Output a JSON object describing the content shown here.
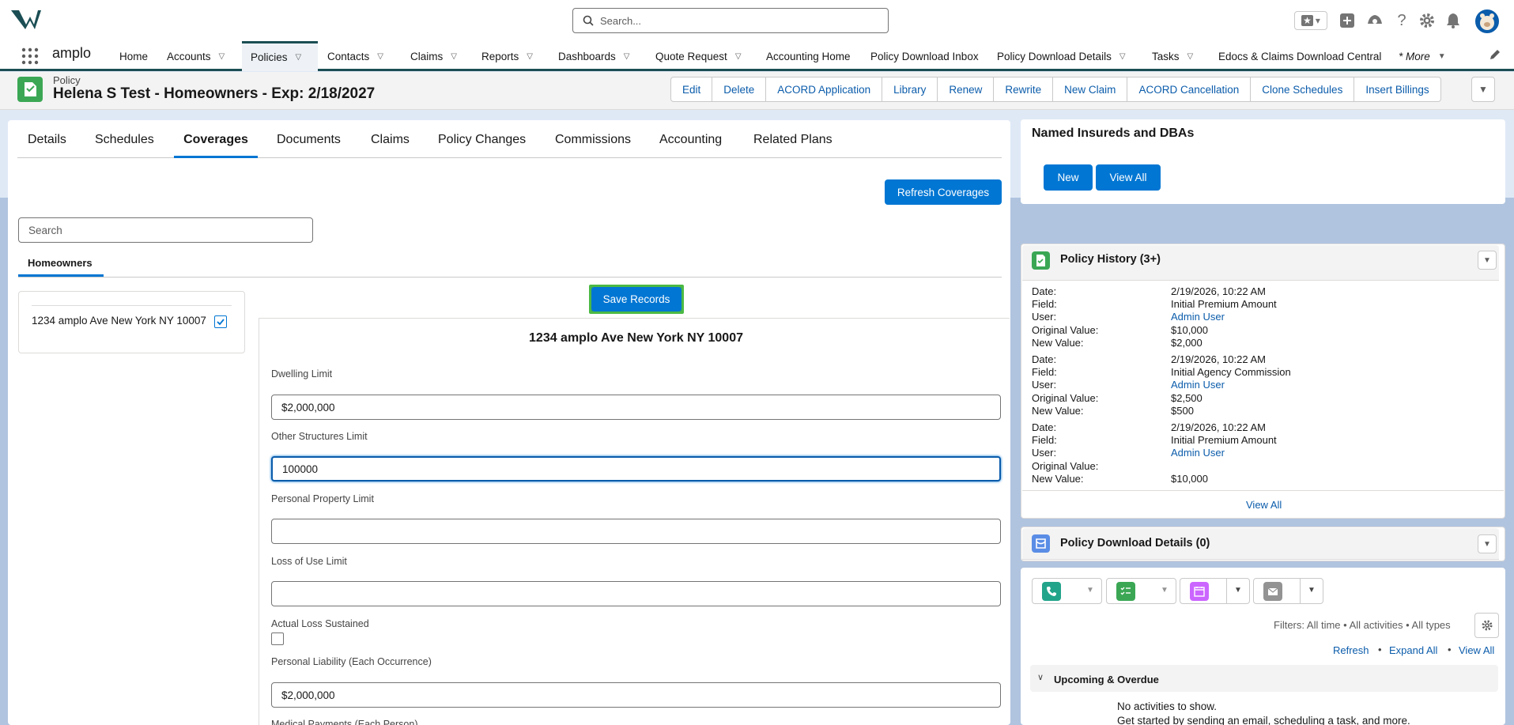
{
  "header": {
    "search_placeholder": "Search..."
  },
  "nav": {
    "app_name": "amplo",
    "items": [
      {
        "label": "Home"
      },
      {
        "label": "Accounts"
      },
      {
        "label": "Policies"
      },
      {
        "label": "Contacts"
      },
      {
        "label": "Claims"
      },
      {
        "label": "Reports"
      },
      {
        "label": "Dashboards"
      },
      {
        "label": "Quote Request"
      },
      {
        "label": "Accounting Home"
      },
      {
        "label": "Policy Download Inbox"
      },
      {
        "label": "Policy Download Details"
      },
      {
        "label": "Tasks"
      },
      {
        "label": "Edocs & Claims Download Central"
      },
      {
        "label": "* More"
      }
    ]
  },
  "record": {
    "type": "Policy",
    "title": "Helena S Test - Homeowners - Exp: 2/18/2027",
    "actions": [
      "Edit",
      "Delete",
      "ACORD Application",
      "Library",
      "Renew",
      "Rewrite",
      "New Claim",
      "ACORD Cancellation",
      "Clone Schedules",
      "Insert Billings"
    ]
  },
  "tabs": [
    "Details",
    "Schedules",
    "Coverages",
    "Documents",
    "Claims",
    "Policy Changes",
    "Commissions",
    "Accounting",
    "Related Plans"
  ],
  "coverages": {
    "refresh_label": "Refresh Coverages",
    "search_placeholder": "Search",
    "subtab": "Homeowners",
    "location": "1234 amplo Ave New York NY 10007",
    "save_label": "Save Records",
    "form_title": "1234 amplo Ave New York NY 10007",
    "fields": [
      {
        "label": "Dwelling Limit",
        "value": "$2,000,000"
      },
      {
        "label": "Other Structures Limit",
        "value": "100000"
      },
      {
        "label": "Personal Property Limit",
        "value": ""
      },
      {
        "label": "Loss of Use Limit",
        "value": ""
      },
      {
        "label": "Actual Loss Sustained",
        "value": ""
      },
      {
        "label": "Personal Liability (Each Occurrence)",
        "value": "$2,000,000"
      },
      {
        "label": "Medical Payments (Each Person)",
        "value": ""
      }
    ]
  },
  "named_insureds": {
    "title": "Named Insureds and DBAs",
    "new_label": "New",
    "view_all_label": "View All"
  },
  "policy_history": {
    "title": "Policy History (3+)",
    "labels": {
      "date": "Date:",
      "field": "Field:",
      "user": "User:",
      "original": "Original Value:",
      "new": "New Value:"
    },
    "entries": [
      {
        "date": "2/19/2026, 10:22 AM",
        "field": "Initial Premium Amount",
        "user": "Admin User",
        "original": "$10,000",
        "new": "$2,000"
      },
      {
        "date": "2/19/2026, 10:22 AM",
        "field": "Initial Agency Commission",
        "user": "Admin User",
        "original": "$2,500",
        "new": "$500"
      },
      {
        "date": "2/19/2026, 10:22 AM",
        "field": "Initial Premium Amount",
        "user": "Admin User",
        "original": "",
        "new": "$10,000"
      }
    ],
    "view_all_label": "View All"
  },
  "policy_download": {
    "title": "Policy Download Details (0)"
  },
  "activity": {
    "filters": "Filters: All time • All activities • All types",
    "refresh": "Refresh",
    "expand_all": "Expand All",
    "view_all": "View All",
    "section": "Upcoming & Overdue",
    "empty": "No activities to show.",
    "hint": "Get started by sending an email, scheduling a task, and more."
  },
  "colors": {
    "brand_blue": "#0176d3",
    "nav_accent": "#1b4e54",
    "policy_green": "#3ba755",
    "highlight_green": "#4cb944"
  }
}
